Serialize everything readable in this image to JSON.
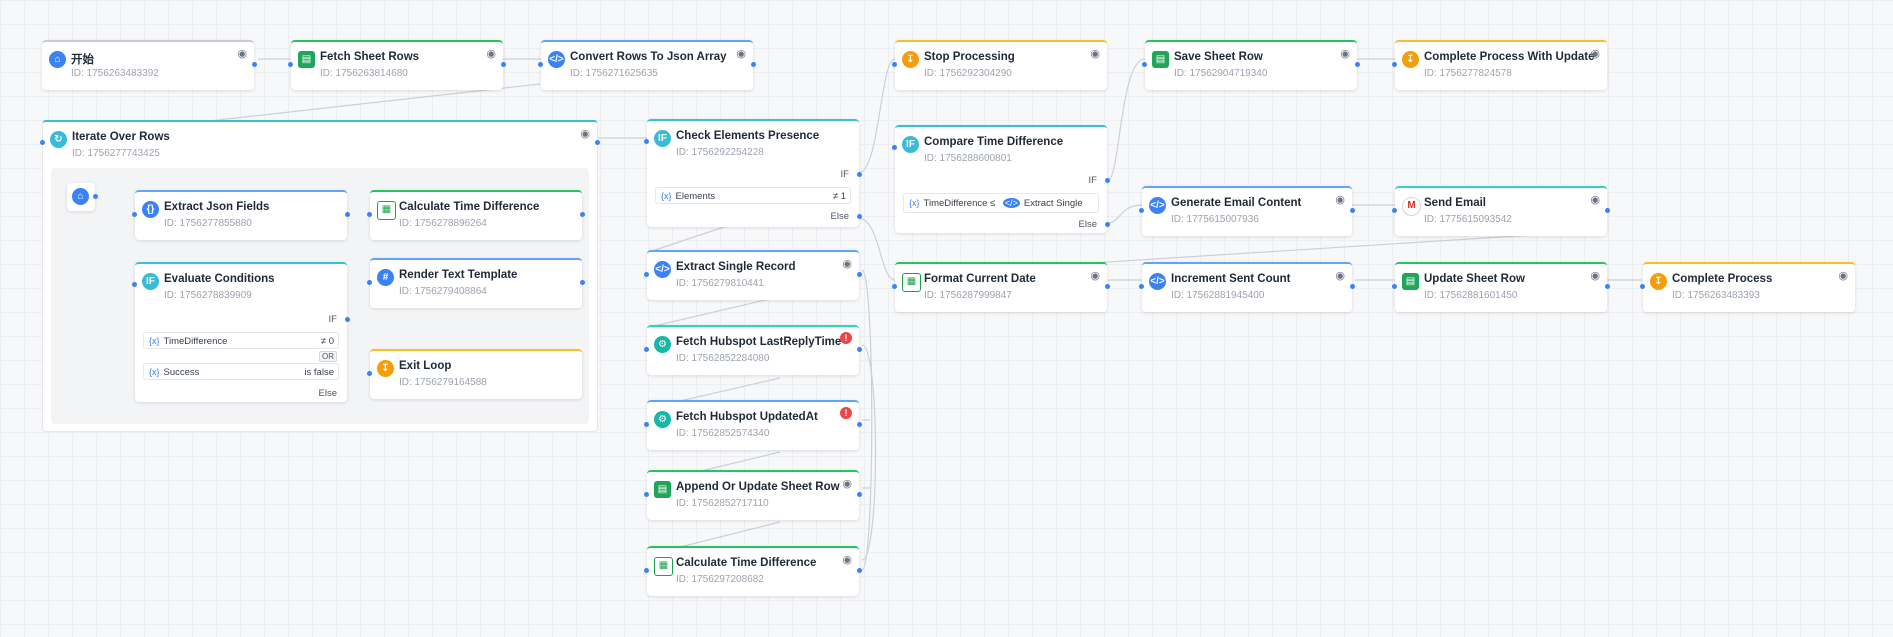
{
  "canvas": {
    "nodes": {
      "start": {
        "title": "开始",
        "id": "ID: 1756263483392"
      },
      "fetch_sheet_rows": {
        "title": "Fetch Sheet Rows",
        "id": "ID: 1756263814680"
      },
      "convert_rows": {
        "title": "Convert Rows To Json Array",
        "id": "ID: 1756271625635"
      },
      "stop_processing": {
        "title": "Stop Processing",
        "id": "ID: 1756292304290"
      },
      "save_sheet_row": {
        "title": "Save Sheet Row",
        "id": "ID: 17562904719340"
      },
      "complete_update": {
        "title": "Complete Process With Update",
        "id": "ID: 1756277824578"
      },
      "iterate": {
        "title": "Iterate Over Rows",
        "id": "ID: 1756277743425"
      },
      "extract_json": {
        "title": "Extract Json Fields",
        "id": "ID: 1756277855880"
      },
      "calc_time_inner": {
        "title": "Calculate Time Difference",
        "id": "ID: 1756278896264"
      },
      "evaluate": {
        "title": "Evaluate Conditions",
        "id": "ID: 1756278839909",
        "if_label": "IF",
        "else_label": "Else",
        "or_label": "OR",
        "conditions": [
          {
            "var": "TimeDifference",
            "op": "≠ 0"
          },
          {
            "var": "Success",
            "op": "is false"
          }
        ]
      },
      "render_text": {
        "title": "Render Text Template",
        "id": "ID: 1756279408864"
      },
      "exit_loop": {
        "title": "Exit Loop",
        "id": "ID: 1756279164588"
      },
      "check_elements": {
        "title": "Check Elements Presence",
        "id": "ID: 1756292254228",
        "if_label": "IF",
        "else_label": "Else",
        "condition": {
          "var": "Elements",
          "op": "≠ 1"
        }
      },
      "extract_single": {
        "title": "Extract Single Record",
        "id": "ID: 1756279810441"
      },
      "fetch_lastreply": {
        "title": "Fetch Hubspot LastReplyTime",
        "id": "ID: 17562852284080"
      },
      "fetch_updated": {
        "title": "Fetch Hubspot UpdatedAt",
        "id": "ID: 17562852574340"
      },
      "append_update": {
        "title": "Append Or Update Sheet Row",
        "id": "ID: 17562852717110"
      },
      "calc_time_outer": {
        "title": "Calculate Time Difference",
        "id": "ID: 1756297208682"
      },
      "compare_time": {
        "title": "Compare Time Difference",
        "id": "ID: 1756288600801",
        "if_label": "IF",
        "else_label": "Else",
        "condition": {
          "var": "TimeDifference",
          "op": "≤",
          "ref": "Extract Single"
        }
      },
      "generate_email": {
        "title": "Generate Email Content",
        "id": "ID: 1775615007936"
      },
      "send_email": {
        "title": "Send Email",
        "id": "ID: 1775615093542"
      },
      "format_date": {
        "title": "Format Current Date",
        "id": "ID: 1756287999847"
      },
      "increment_count": {
        "title": "Increment Sent Count",
        "id": "ID: 17562881945400"
      },
      "update_sheet_row": {
        "title": "Update Sheet Row",
        "id": "ID: 17562881601450"
      },
      "complete_process": {
        "title": "Complete Process",
        "id": "ID: 1756263483393"
      }
    }
  }
}
